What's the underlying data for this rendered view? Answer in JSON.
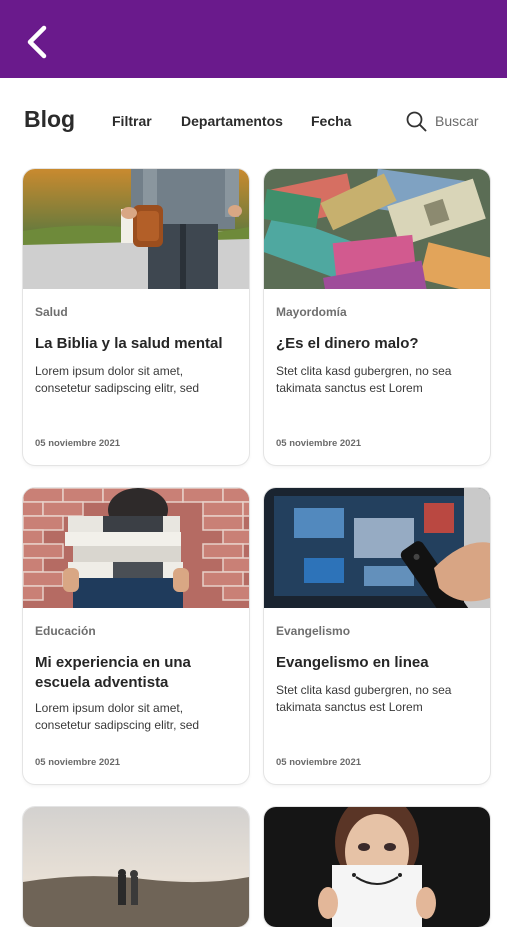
{
  "header": {
    "back_icon": "chevron-left-icon",
    "background": "#6a1a8c"
  },
  "filterbar": {
    "title": "Blog",
    "filter_label": "Filtrar",
    "departments_label": "Departamentos",
    "date_label": "Fecha",
    "search_placeholder": "Buscar",
    "search_icon": "search-icon"
  },
  "posts": [
    {
      "category": "Salud",
      "title": "La Biblia y la salud mental",
      "excerpt": "Lorem ipsum dolor sit amet, consetetur sadipscing elitr, sed",
      "date": "05 noviembre 2021",
      "image": "man-holding-bible-image"
    },
    {
      "category": "Mayordomía",
      "title": "¿Es el dinero malo?",
      "excerpt": "Stet clita kasd gubergren, no sea takimata sanctus est Lorem",
      "date": "05 noviembre 2021",
      "image": "banknotes-image"
    },
    {
      "category": "Educación",
      "title": "Mi experiencia en una escuela adventista",
      "excerpt": "Lorem ipsum dolor sit amet, consetetur sadipscing elitr, sed",
      "date": "05  noviembre 2021",
      "image": "stack-of-books-image"
    },
    {
      "category": "Evangelismo",
      "title": "Evangelismo en linea",
      "excerpt": "Stet clita kasd gubergren, no sea takimata sanctus est Lorem",
      "date": "05 noviembre 2021",
      "image": "tv-remote-image"
    },
    {
      "image": "couple-walking-image"
    },
    {
      "image": "woman-with-smile-sign-image"
    }
  ]
}
